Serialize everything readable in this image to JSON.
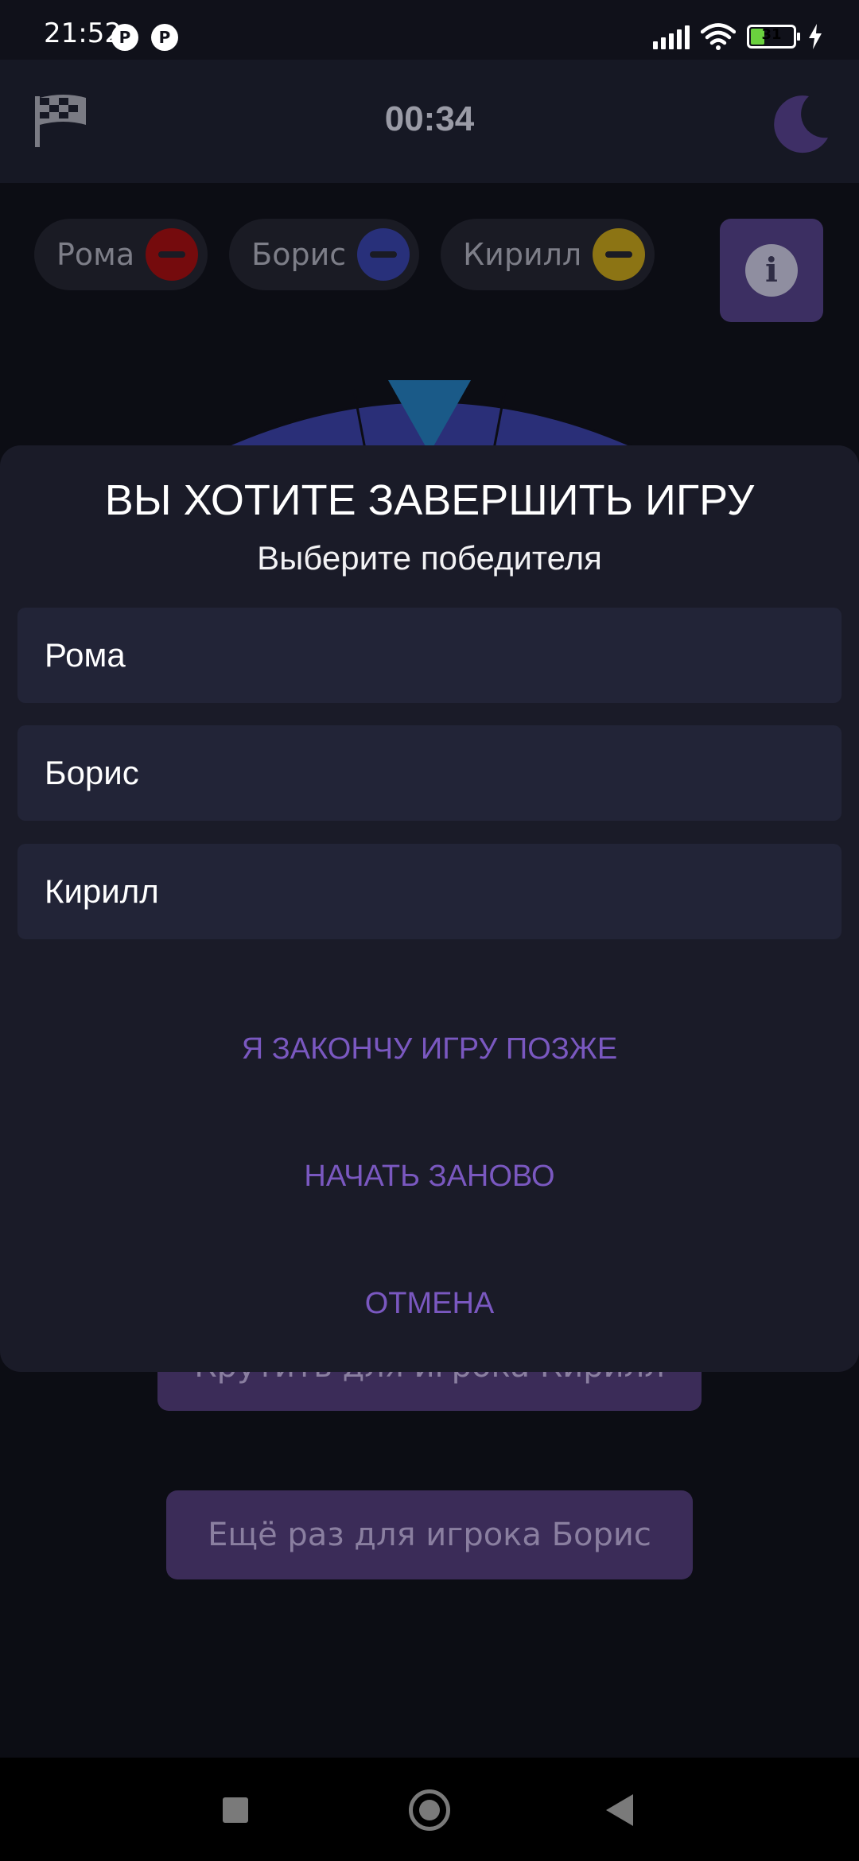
{
  "status_bar": {
    "time": "21:52",
    "battery_level": "31",
    "icons": [
      "notification-app-icon",
      "notification-app-icon",
      "signal-icon",
      "wifi-icon",
      "battery-icon",
      "charging-icon"
    ]
  },
  "app_bar": {
    "timer": "00:34",
    "left_icon": "checkered-flag-icon",
    "right_icon": "moon-icon"
  },
  "players": [
    {
      "name": "Рома",
      "color": "#b00e10"
    },
    {
      "name": "Борис",
      "color": "#3b45b0"
    },
    {
      "name": "Кирилл",
      "color": "#c8a81e"
    }
  ],
  "info_button_icon": "info-icon",
  "dialog": {
    "title": "ВЫ ХОТИТЕ ЗАВЕРШИТЬ ИГРУ",
    "subtitle": "Выберите победителя",
    "options": [
      "Рома",
      "Борис",
      "Кирилл"
    ],
    "later_label": "Я ЗАКОНЧУ ИГРУ ПОЗЖЕ",
    "restart_label": "НАЧАТЬ ЗАНОВО",
    "cancel_label": "ОТМЕНА"
  },
  "background_buttons": {
    "spin_label": "Крутить для игрока Кирилл",
    "again_label": "Ещё раз для игрока Борис"
  },
  "colors": {
    "accent": "#7a58c0",
    "dialog_bg": "#1a1b28",
    "option_bg": "#222437",
    "wheel_blue": "#3b40a8",
    "pointer": "#1e6fa0"
  }
}
